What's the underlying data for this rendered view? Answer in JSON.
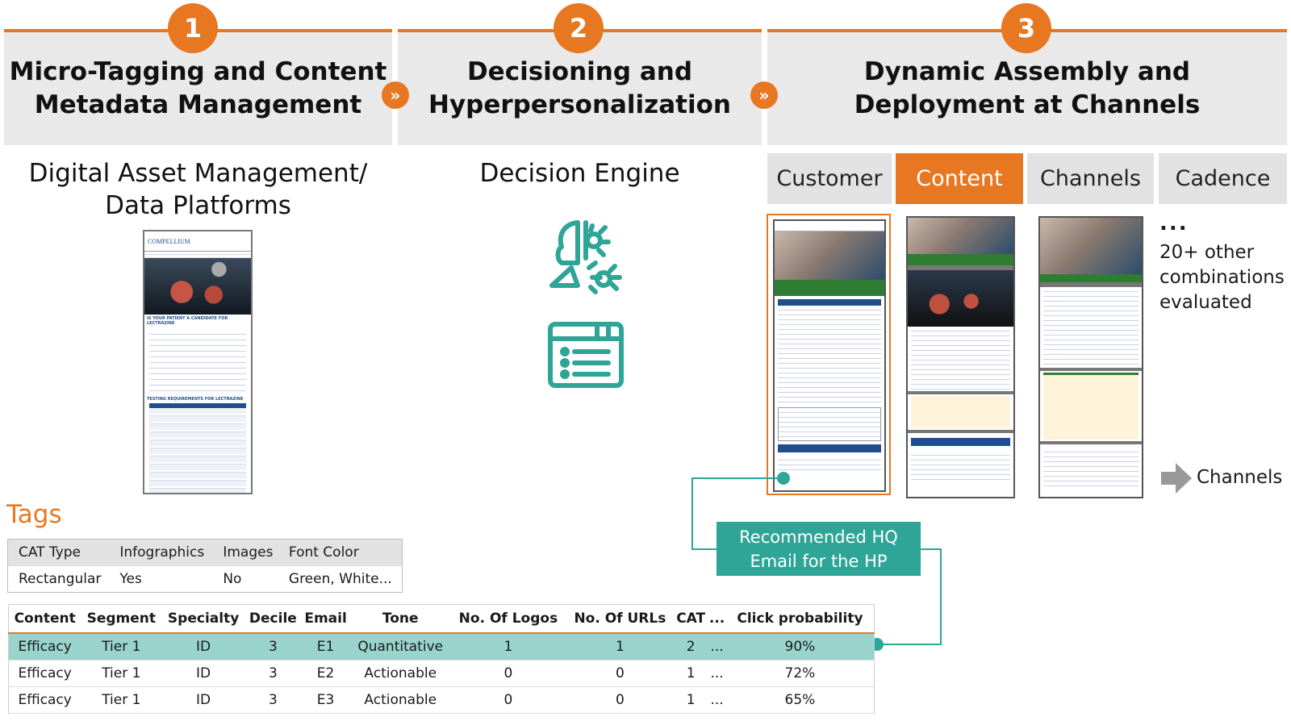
{
  "stages": [
    {
      "number": "1",
      "title": "Micro-Tagging and Content\nMetadata Management"
    },
    {
      "number": "2",
      "title": "Decisioning and\nHyperpersonalization"
    },
    {
      "number": "3",
      "title": "Dynamic Assembly and\nDeployment at Channels"
    }
  ],
  "chevron": "»",
  "subheads": {
    "dam": "Digital Asset Management/\nData Platforms",
    "engine": "Decision Engine"
  },
  "tabs": [
    {
      "label": "Customer",
      "active": false
    },
    {
      "label": "Content",
      "active": true
    },
    {
      "label": "Channels",
      "active": false
    },
    {
      "label": "Cadence",
      "active": false
    }
  ],
  "doc_preview": {
    "brand": "COMPELLIUM",
    "section1": "IS YOUR PATIENT A CANDIDATE FOR LECTRAZINE",
    "section2": "TESTING REQUIREMENTS FOR LECTRAZINE"
  },
  "other_combos": {
    "ellipsis": "...",
    "text": "20+ other\ncombinations\nevaluated"
  },
  "channels_label": "Channels",
  "recommendation": "Recommended HQ\nEmail for the HP",
  "tags": {
    "title": "Tags",
    "headers": [
      "CAT Type",
      "Infographics",
      "Images",
      "Font Color"
    ],
    "row": [
      "Rectangular",
      "Yes",
      "No",
      "Green, White..."
    ]
  },
  "decision_table": {
    "headers": [
      "Content",
      "Segment",
      "Specialty",
      "Decile",
      "Email",
      "Tone",
      "No. Of Logos",
      "No. Of URLs",
      "CAT",
      "...",
      "Click probability"
    ],
    "rows": [
      [
        "Efficacy",
        "Tier 1",
        "ID",
        "3",
        "E1",
        "Quantitative",
        "1",
        "1",
        "2",
        "...",
        "90%"
      ],
      [
        "Efficacy",
        "Tier 1",
        "ID",
        "3",
        "E2",
        "Actionable",
        "0",
        "0",
        "1",
        "...",
        "72%"
      ],
      [
        "Efficacy",
        "Tier 1",
        "ID",
        "3",
        "E3",
        "Actionable",
        "0",
        "0",
        "1",
        "...",
        "65%"
      ]
    ]
  },
  "colors": {
    "accent": "#e87722",
    "teal": "#2ea597",
    "highlight": "#98d4cb"
  },
  "icons": [
    "brain-gear-icon",
    "content-list-icon",
    "arrow-right-icon"
  ]
}
